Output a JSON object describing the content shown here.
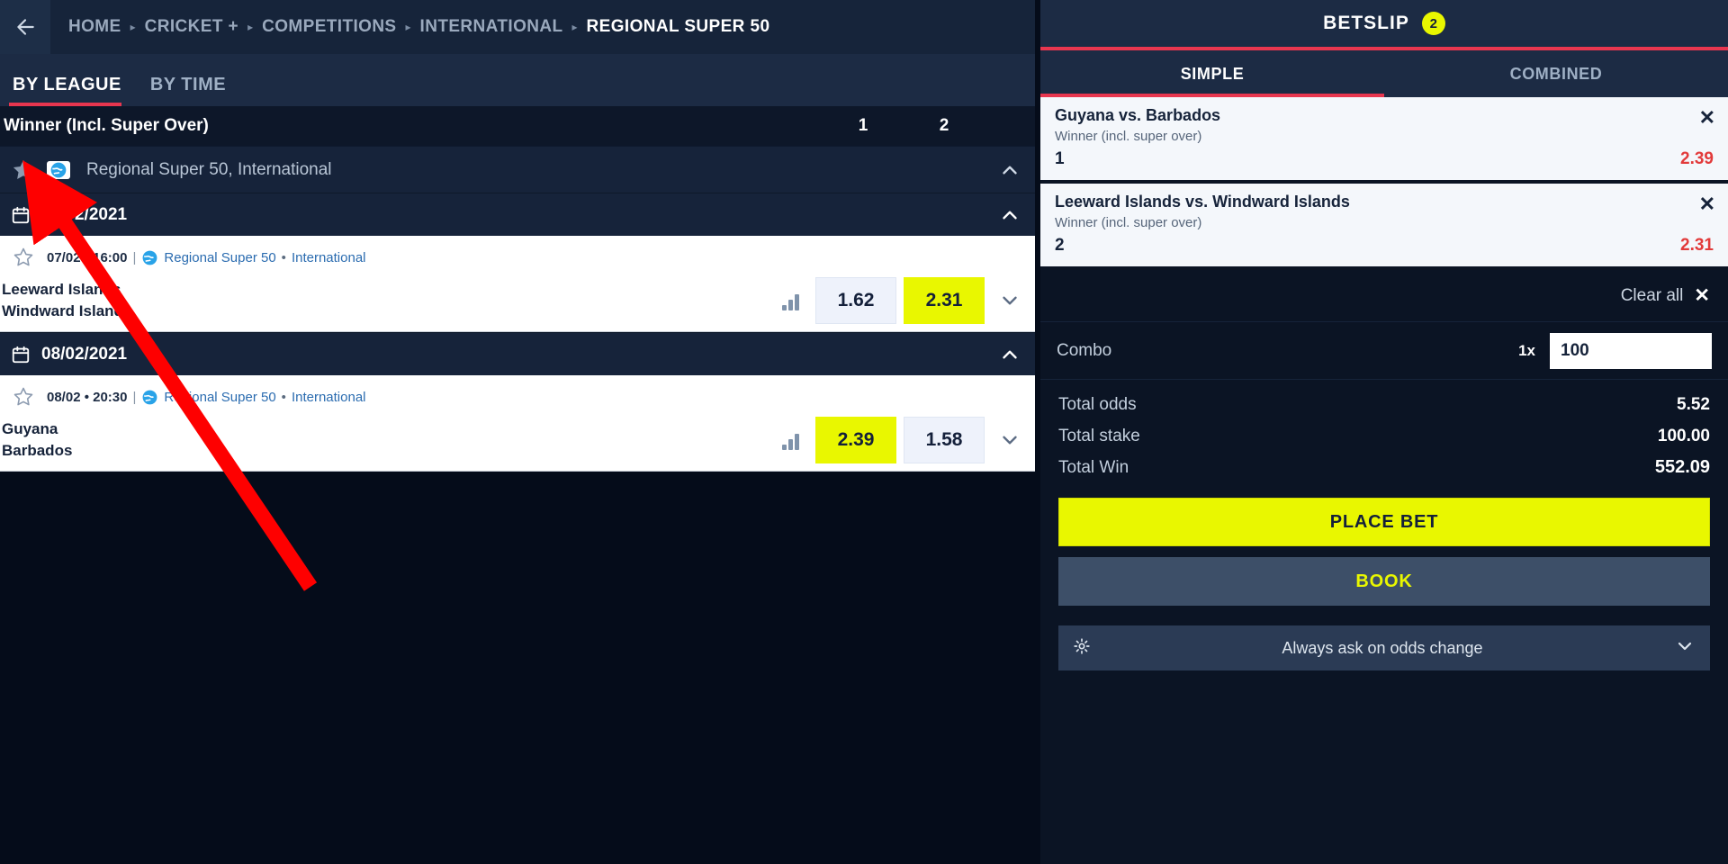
{
  "breadcrumb": {
    "back_icon": "arrow-left-icon",
    "items": [
      {
        "label": "HOME",
        "current": false
      },
      {
        "label": "CRICKET +",
        "current": false
      },
      {
        "label": "COMPETITIONS",
        "current": false
      },
      {
        "label": "INTERNATIONAL",
        "current": false
      },
      {
        "label": "REGIONAL SUPER 50",
        "current": true
      }
    ],
    "separator": "▸"
  },
  "tabs": [
    {
      "label": "BY LEAGUE",
      "active": true
    },
    {
      "label": "BY TIME",
      "active": false
    }
  ],
  "market": {
    "title": "Winner (Incl. Super Over)",
    "columns": [
      "1",
      "2"
    ]
  },
  "league": {
    "name": "Regional Super 50, International",
    "favorited": true,
    "collapse_icon": "chevron-up-icon"
  },
  "days": [
    {
      "date": "07/02/2021",
      "calendar_icon": "calendar-icon",
      "collapse_icon": "chevron-up-icon",
      "events": [
        {
          "time": "07/02 • 16:00",
          "league": "Regional Super 50",
          "category": "International",
          "favorited": false,
          "home": "Leeward Islands",
          "away": "Windward Islands",
          "stats_icon": "bar-chart-icon",
          "odds": [
            {
              "value": "1.62",
              "selected": false
            },
            {
              "value": "2.31",
              "selected": true
            }
          ],
          "expand_icon": "chevron-down-icon"
        }
      ]
    },
    {
      "date": "08/02/2021",
      "calendar_icon": "calendar-icon",
      "collapse_icon": "chevron-up-icon",
      "events": [
        {
          "time": "08/02 • 20:30",
          "league": "Regional Super 50",
          "category": "International",
          "favorited": false,
          "home": "Guyana",
          "away": "Barbados",
          "stats_icon": "bar-chart-icon",
          "odds": [
            {
              "value": "2.39",
              "selected": true
            },
            {
              "value": "1.58",
              "selected": false
            }
          ],
          "expand_icon": "chevron-down-icon"
        }
      ]
    }
  ],
  "betslip": {
    "title": "BETSLIP",
    "count": "2",
    "tabs": [
      {
        "label": "SIMPLE",
        "active": true
      },
      {
        "label": "COMBINED",
        "active": false
      }
    ],
    "selections": [
      {
        "match": "Guyana vs. Barbados",
        "market": "Winner (incl. super over)",
        "pick": "1",
        "odds": "2.39",
        "close_icon": "close-icon"
      },
      {
        "match": "Leeward Islands vs. Windward Islands",
        "market": "Winner (incl. super over)",
        "pick": "2",
        "odds": "2.31",
        "close_icon": "close-icon"
      }
    ],
    "clear_all": {
      "label": "Clear all",
      "icon": "close-icon"
    },
    "combo": {
      "label": "Combo",
      "multiplier": "1x",
      "stake": "100"
    },
    "totals": [
      {
        "label": "Total odds",
        "value": "5.52"
      },
      {
        "label": "Total stake",
        "value": "100.00"
      },
      {
        "label": "Total Win",
        "value": "552.09"
      }
    ],
    "place_bet_label": "PLACE BET",
    "book_label": "BOOK",
    "odds_change": {
      "gear_icon": "gear-icon",
      "label": "Always ask on odds change",
      "chevron_icon": "chevron-down-icon"
    }
  },
  "colors": {
    "accent_red": "#e8364f",
    "odds_yellow": "#e9f700",
    "panel_dark": "#16233a",
    "bg_dark": "#050c1a",
    "annotation_red": "#fe0000"
  }
}
